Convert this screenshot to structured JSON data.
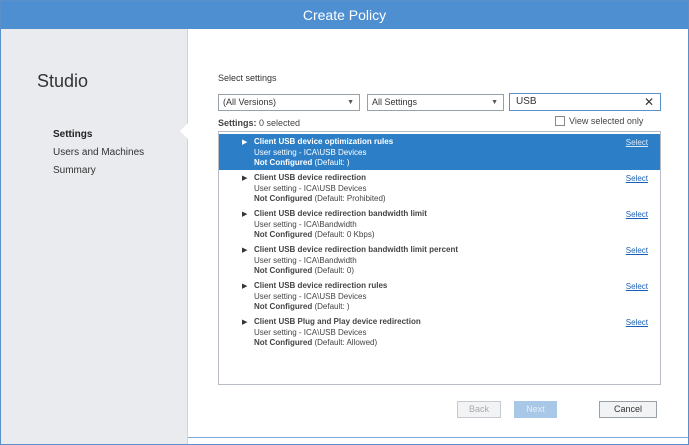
{
  "window": {
    "title": "Create Policy"
  },
  "sidebar": {
    "app_name": "Studio",
    "items": [
      {
        "label": "Settings",
        "active": true
      },
      {
        "label": "Users and Machines",
        "active": false
      },
      {
        "label": "Summary",
        "active": false
      }
    ]
  },
  "main": {
    "section_label": "Select settings",
    "filters": {
      "version": "(All Versions)",
      "category": "All Settings",
      "search": "USB"
    },
    "settings_prefix": "Settings:",
    "settings_count": "0 selected",
    "view_selected_only": "View selected only",
    "select_label": "Select",
    "settings": [
      {
        "name": "Client USB device optimization rules",
        "path": "User setting - ICA\\USB Devices",
        "state_label": "Not Configured",
        "state_default": "(Default: )",
        "selected": true
      },
      {
        "name": "Client USB device redirection",
        "path": "User setting - ICA\\USB Devices",
        "state_label": "Not Configured",
        "state_default": "(Default: Prohibited)",
        "selected": false
      },
      {
        "name": "Client USB device redirection bandwidth limit",
        "path": "User setting - ICA\\Bandwidth",
        "state_label": "Not Configured",
        "state_default": "(Default: 0 Kbps)",
        "selected": false
      },
      {
        "name": "Client USB device redirection bandwidth limit percent",
        "path": "User setting - ICA\\Bandwidth",
        "state_label": "Not Configured",
        "state_default": "(Default: 0)",
        "selected": false
      },
      {
        "name": "Client USB device redirection rules",
        "path": "User setting - ICA\\USB Devices",
        "state_label": "Not Configured",
        "state_default": "(Default: )",
        "selected": false
      },
      {
        "name": "Client USB Plug and Play device redirection",
        "path": "User setting - ICA\\USB Devices",
        "state_label": "Not Configured",
        "state_default": "(Default: Allowed)",
        "selected": false
      }
    ]
  },
  "footer": {
    "back_label": "Back",
    "next_label": "Next",
    "cancel_label": "Cancel"
  },
  "colors": {
    "title_bar": "#4d8fd1",
    "selection": "#2c7fc7",
    "link": "#1a5fb4"
  }
}
